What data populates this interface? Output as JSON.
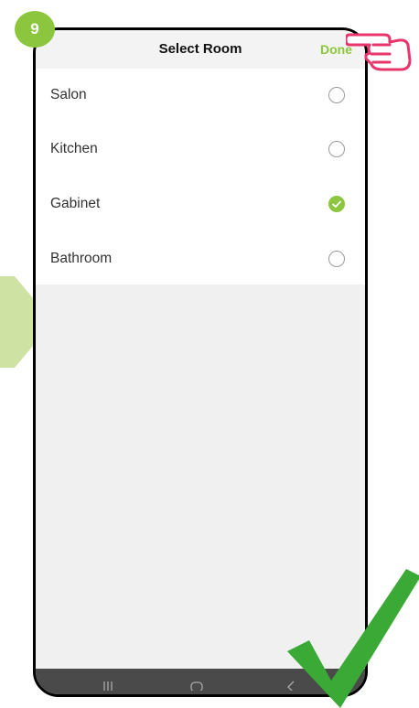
{
  "step": {
    "number": "9"
  },
  "header": {
    "title": "Select Room",
    "done_label": "Done"
  },
  "rooms": [
    {
      "label": "Salon",
      "selected": false
    },
    {
      "label": "Kitchen",
      "selected": false
    },
    {
      "label": "Gabinet",
      "selected": true
    },
    {
      "label": "Bathroom",
      "selected": false
    }
  ],
  "colors": {
    "accent": "#8cc63f",
    "check_mark": "#3aa935",
    "hand": "#e8356b",
    "nav_bar": "#4a4a4a"
  },
  "icons": {
    "selected": "check-circle-icon",
    "unselected": "radio-empty-icon",
    "pointer": "hand-pointer-icon",
    "nav": [
      "recent-apps-icon",
      "home-icon",
      "back-icon"
    ]
  }
}
